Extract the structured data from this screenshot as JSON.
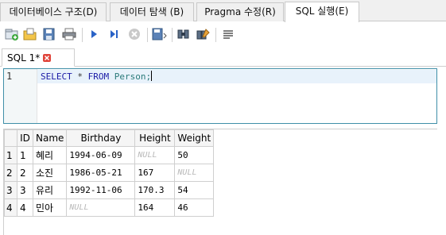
{
  "main_tabs": [
    {
      "label": "데이터베이스 구조(D)",
      "active": false
    },
    {
      "label": "데이터 탐색 (B)",
      "active": false
    },
    {
      "label": "Pragma 수정(R)",
      "active": false
    },
    {
      "label": "SQL 실행(E)",
      "active": true
    }
  ],
  "toolbar": {
    "icons": [
      "new-tab-icon",
      "open-sql-icon",
      "save-sql-icon",
      "print-icon",
      "execute-all-icon",
      "execute-current-line-icon",
      "stop-execution-icon",
      "save-results-icon",
      "find-icon",
      "find-replace-icon",
      "comment-icon"
    ]
  },
  "editor_tab": {
    "label": "SQL 1*"
  },
  "editor": {
    "line_number": "1",
    "code": {
      "kw1": "SELECT",
      "star": " * ",
      "kw2": "FROM",
      "table": " Person;"
    }
  },
  "results": {
    "columns": [
      "ID",
      "Name",
      "Birthday",
      "Height",
      "Weight"
    ],
    "rows": [
      {
        "rownum": "1",
        "id": "1",
        "name": "혜리",
        "birthday": "1994-06-09",
        "height": "NULL",
        "weight": "50"
      },
      {
        "rownum": "2",
        "id": "2",
        "name": "소진",
        "birthday": "1986-05-21",
        "height": "167",
        "weight": "NULL"
      },
      {
        "rownum": "3",
        "id": "3",
        "name": "유리",
        "birthday": "1992-11-06",
        "height": "170.3",
        "weight": "54"
      },
      {
        "rownum": "4",
        "id": "4",
        "name": "민아",
        "birthday": "NULL",
        "height": "164",
        "weight": "46"
      }
    ]
  },
  "colors": {
    "editor_border": "#3f8fa8",
    "keyword": "#1a1aa6",
    "identifier": "#2a7a7a",
    "null_text": "#b8b8b8",
    "current_line": "#e8f2fb"
  }
}
